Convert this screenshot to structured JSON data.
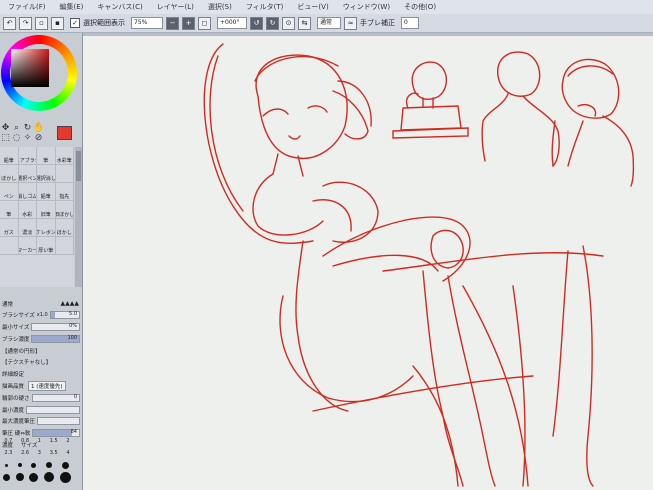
{
  "menubar": {
    "items": [
      "ファイル(F)",
      "編集(E)",
      "キャンバス(C)",
      "レイヤー(L)",
      "選択(S)",
      "フィルタ(T)",
      "ビュー(V)",
      "ウィンドウ(W)",
      "その他(O)"
    ]
  },
  "toolbar": {
    "select_display_label": "選択範囲表示",
    "zoom": "75%",
    "rotation": "+000°",
    "blend_mode": "通常",
    "stabilizer_label": "手ブレ補正",
    "stabilizer_value": "0"
  },
  "color": {
    "primary": "#e23a2e"
  },
  "brushes": {
    "rows": [
      [
        "鉛筆",
        "エアブラシ",
        "筆",
        "水彩筆"
      ],
      [
        "ぼかし",
        "選択ペン",
        "選択消し",
        ""
      ],
      [
        "ペン",
        "消しゴム",
        "鉛筆",
        "指先"
      ],
      [
        "筆",
        "水彩",
        "旧筆",
        "旧ぼかし"
      ],
      [
        "ガス",
        "濃淡",
        "ケレボン",
        "ぼかし"
      ],
      [
        "",
        "マーカー",
        "厚い筆",
        ""
      ]
    ]
  },
  "properties": {
    "mode_label": "通常",
    "brush_size_label": "ブラシサイズ",
    "brush_size_multiplier": "x1.0",
    "brush_size_value": "5.0",
    "min_size_label": "最小サイズ",
    "min_size_value": "0%",
    "density_label": "ブラシ濃度",
    "density_value": "100",
    "edge_label": "【通常の円形】",
    "texture_label": "【テクスチャなし】",
    "detail_label": "詳細設定",
    "quality_label": "描画品質",
    "quality_value": "1 (速度優先)",
    "edge_hardness_label": "輪郭の硬さ",
    "edge_hardness_value": "0",
    "min_density_label": "最小濃度",
    "max_pressure_label": "最大濃度筆圧",
    "pressure_label": "筆圧 硬⇔軟",
    "pressure_value": "84",
    "pressure_density": "濃度",
    "pressure_size": "サイズ"
  },
  "sizes": {
    "row1": [
      "0.7",
      "0.8",
      "1",
      "1.5",
      "2"
    ],
    "row2": [
      "2.3",
      "2.6",
      "3",
      "3.5",
      "4"
    ]
  }
}
